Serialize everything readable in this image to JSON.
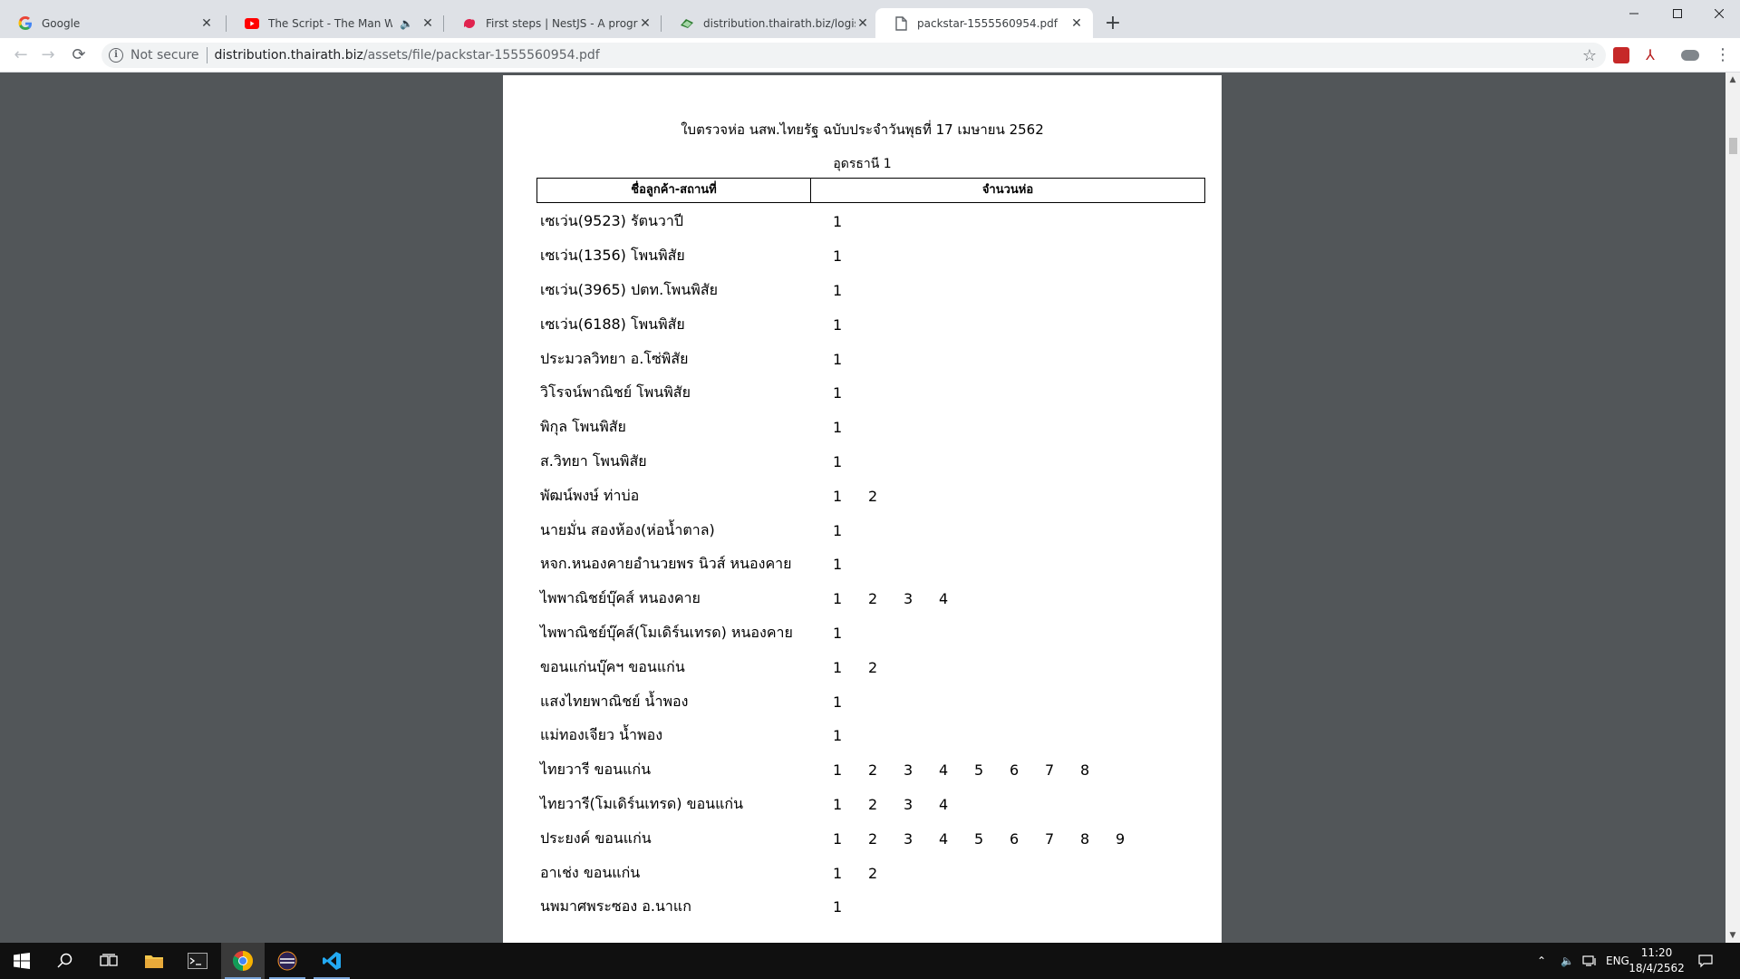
{
  "browser": {
    "tabs": [
      {
        "title": "Google",
        "icon": "google-icon",
        "active": false
      },
      {
        "title": "The Script - The Man Who Ca",
        "icon": "youtube-icon",
        "active": false,
        "audio": true
      },
      {
        "title": "First steps | NestJS - A progressive",
        "icon": "nestjs-icon",
        "active": false
      },
      {
        "title": "distribution.thairath.biz/logistics/",
        "icon": "site-icon",
        "active": false
      },
      {
        "title": "packstar-1555560954.pdf",
        "icon": "document-icon",
        "active": true
      }
    ],
    "security_label": "Not secure",
    "url_domain": "distribution.thairath.biz",
    "url_path": "/assets/file/packstar-1555560954.pdf"
  },
  "document": {
    "title": "ใบตรวจห่อ นสพ.ไทยรัฐ ฉบับประจำวันพุธที่  17 เมษายน 2562",
    "subtitle": "อุดรธานี 1",
    "col_customer": "ชื่อลูกค้า-สถานที่",
    "col_packages": "จำนวนห่อ",
    "rows": [
      {
        "name": "เซเว่น(9523)  รัตนวาปี",
        "nums": [
          "1"
        ]
      },
      {
        "name": "เซเว่น(1356)  โพนพิสัย",
        "nums": [
          "1"
        ]
      },
      {
        "name": "เซเว่น(3965)  ปตท.โพนพิสัย",
        "nums": [
          "1"
        ]
      },
      {
        "name": "เซเว่น(6188)  โพนพิสัย",
        "nums": [
          "1"
        ]
      },
      {
        "name": "ประมวลวิทยา  อ.โซ่พิสัย",
        "nums": [
          "1"
        ]
      },
      {
        "name": "วิโรจน์พาณิชย์  โพนพิสัย",
        "nums": [
          "1"
        ]
      },
      {
        "name": "พิกุล  โพนพิสัย",
        "nums": [
          "1"
        ]
      },
      {
        "name": "ส.วิทยา  โพนพิสัย",
        "nums": [
          "1"
        ]
      },
      {
        "name": "พัฒน์พงษ์  ท่าบ่อ",
        "nums": [
          "1",
          "2"
        ]
      },
      {
        "name": "นายมั่น  สองห้อง(ห่อน้ำตาล)",
        "nums": [
          "1"
        ]
      },
      {
        "name": "หจก.หนองคายอำนวยพร นิวส์  หนองคาย",
        "nums": [
          "1"
        ]
      },
      {
        "name": "ไพพาณิชย์บุ๊คส์  หนองคาย",
        "nums": [
          "1",
          "2",
          "3",
          "4"
        ]
      },
      {
        "name": "ไพพาณิชย์บุ๊คส์(โมเดิร์นเทรด)  หนองคาย",
        "nums": [
          "1"
        ]
      },
      {
        "name": "ขอนแก่นบุ๊คฯ  ขอนแก่น",
        "nums": [
          "1",
          "2"
        ]
      },
      {
        "name": "แสงไทยพาณิชย์  น้ำพอง",
        "nums": [
          "1"
        ]
      },
      {
        "name": "แม่ทองเจียว  น้ำพอง",
        "nums": [
          "1"
        ]
      },
      {
        "name": "ไทยวารี   ขอนแก่น",
        "nums": [
          "1",
          "2",
          "3",
          "4",
          "5",
          "6",
          "7",
          "8"
        ]
      },
      {
        "name": "ไทยวารี(โมเดิร์นเทรด)   ขอนแก่น",
        "nums": [
          "1",
          "2",
          "3",
          "4"
        ]
      },
      {
        "name": "ประยงค์  ขอนแก่น",
        "nums": [
          "1",
          "2",
          "3",
          "4",
          "5",
          "6",
          "7",
          "8",
          "9"
        ]
      },
      {
        "name": "อาเช่ง  ขอนแก่น",
        "nums": [
          "1",
          "2"
        ]
      },
      {
        "name": "นพมาศพระซอง  อ.นาแก",
        "nums": [
          "1"
        ]
      }
    ]
  },
  "taskbar": {
    "language": "ENG",
    "time": "11:20",
    "date": "18/4/2562"
  }
}
